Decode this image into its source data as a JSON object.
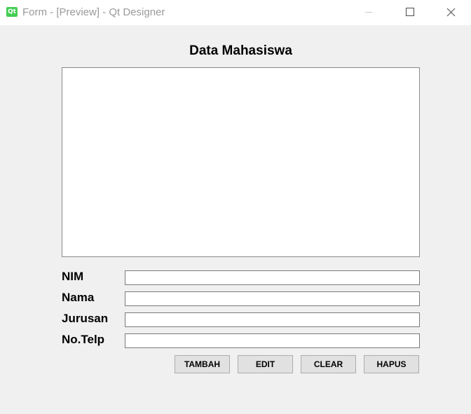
{
  "window": {
    "title": "Form - [Preview] - Qt Designer",
    "icon": "qt-designer-icon",
    "icon_text": "Qt",
    "controls": [
      "minimize-icon",
      "maximize-icon",
      "close-icon"
    ]
  },
  "form": {
    "title": "Data Mahasiswa",
    "fields": [
      {
        "label": "NIM",
        "value": "",
        "placeholder": ""
      },
      {
        "label": "Nama",
        "value": "",
        "placeholder": ""
      },
      {
        "label": "Jurusan",
        "value": "",
        "placeholder": ""
      },
      {
        "label": "No.Telp",
        "value": "",
        "placeholder": ""
      }
    ],
    "buttons": [
      {
        "label": "TAMBAH"
      },
      {
        "label": "EDIT"
      },
      {
        "label": "CLEAR"
      },
      {
        "label": "HAPUS"
      }
    ]
  },
  "colors": {
    "background": "#f0f0f0",
    "titlebar": "#ffffff",
    "title_text": "#9a9a9a",
    "qt_icon": "#41cd52",
    "button_face": "#e1e1e1"
  }
}
